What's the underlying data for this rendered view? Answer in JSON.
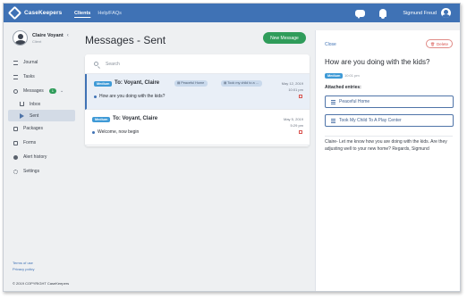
{
  "app": {
    "logo_text": "CaseKeepers",
    "nav": [
      {
        "label": "Clients",
        "active": true
      },
      {
        "label": "Help/FAQs",
        "active": false
      }
    ],
    "user_name": "Sigmund Freud"
  },
  "sidebar": {
    "client_name": "Claire Voyant",
    "client_role": "Client",
    "items": [
      {
        "label": "Journal",
        "icon": "list-icon"
      },
      {
        "label": "Tasks",
        "icon": "list-icon"
      },
      {
        "label": "Messages",
        "icon": "chat-icon",
        "badge": "1"
      },
      {
        "label": "Inbox",
        "icon": "inbox-icon"
      },
      {
        "label": "Sent",
        "icon": "send-icon",
        "active": true
      },
      {
        "label": "Packages",
        "icon": "box-icon"
      },
      {
        "label": "Forms",
        "icon": "form-icon"
      },
      {
        "label": "Alert history",
        "icon": "alert-icon"
      },
      {
        "label": "Settings",
        "icon": "gear-icon"
      }
    ],
    "footer": {
      "terms": "Terms of use",
      "privacy": "Privacy policy",
      "copyright": "© 2019 COPYRIGHT CaseKeepers"
    }
  },
  "main": {
    "title": "Messages - Sent",
    "new_message_label": "New Message",
    "search_placeholder": "Search",
    "messages": [
      {
        "priority": "Medium",
        "to": "To: Voyant, Claire",
        "chips": [
          "Peaceful Home",
          "Took my child to a ..."
        ],
        "date": "May 12, 2019",
        "time": "10:01 pm",
        "preview": "How are you doing with the kids?",
        "selected": true
      },
      {
        "priority": "Medium",
        "to": "To: Voyant, Claire",
        "chips": [],
        "date": "May 5, 2019",
        "time": "5:29 pm",
        "preview": "Welcome, now begin",
        "selected": false
      }
    ]
  },
  "detail": {
    "close_label": "Close",
    "delete_label": "Delete",
    "title": "How are you doing with the kids?",
    "priority": "Medium",
    "time": "10:01 pm",
    "attached_label": "Attached entries:",
    "entries": [
      "Peaceful Home",
      "Took My Child To A Play Center"
    ],
    "body": "Claire- Let me know how you are doing with the kids. Are they adjusting well to your new home? Regards, Sigmund"
  },
  "colors": {
    "topbar": "#3f72b5",
    "accent_green": "#2f9c5a",
    "priority_blue": "#3f9ad6",
    "danger": "#d9534f"
  }
}
